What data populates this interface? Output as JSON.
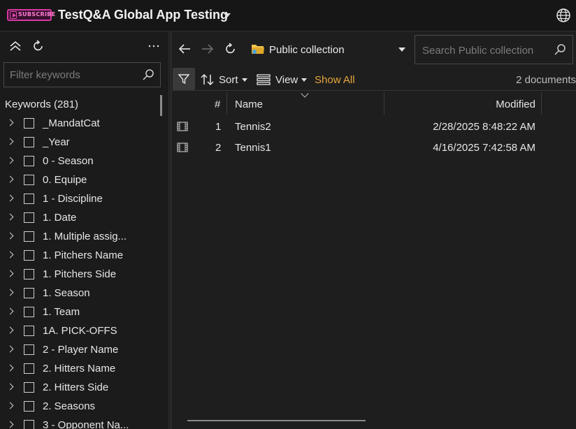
{
  "titlebar": {
    "logo_text": "SUBSCRIBE",
    "app_title": "TestQ&A Global App Testing",
    "globe_icon": "globe-icon"
  },
  "left_panel": {
    "filter_placeholder": "Filter keywords",
    "keywords_header": "Keywords (281)",
    "keywords": [
      "_MandatCat",
      "_Year",
      "0 - Season",
      "0. Equipe",
      "1 - Discipline",
      "1. Date",
      "1. Multiple assig...",
      "1. Pitchers Name",
      "1. Pitchers Side",
      "1. Season",
      "1. Team",
      "1A. PICK-OFFS",
      "2 - Player Name",
      "2. Hitters Name",
      "2. Hitters Side",
      "2. Seasons",
      "3 - Opponent Na..."
    ]
  },
  "right_panel": {
    "collection_name": "Public collection",
    "search_placeholder": "Search Public collection",
    "toolbar": {
      "sort_label": "Sort",
      "view_label": "View",
      "show_all_label": "Show All",
      "doc_count": "2 documents"
    },
    "columns": {
      "num": "#",
      "name": "Name",
      "modified": "Modified"
    },
    "rows": [
      {
        "num": "1",
        "name": "Tennis2",
        "modified": "2/28/2025 8:48:22 AM"
      },
      {
        "num": "2",
        "name": "Tennis1",
        "modified": "4/16/2025 7:42:58 AM"
      }
    ]
  },
  "colors": {
    "accent_show_all": "#e5a73b",
    "logo": "#d63aa3",
    "folder": "#f2c44e"
  }
}
